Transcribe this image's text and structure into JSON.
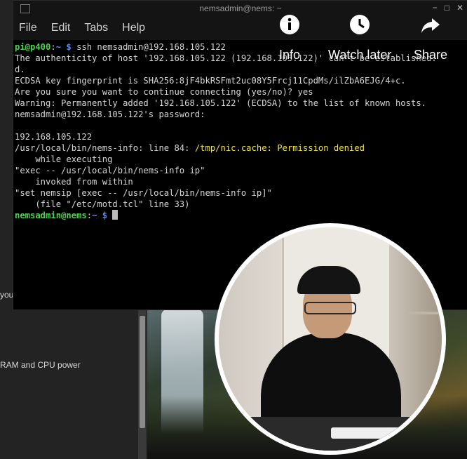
{
  "window": {
    "title": "nemsadmin@nems: ~"
  },
  "menu": [
    "File",
    "Edit",
    "Tabs",
    "Help"
  ],
  "terminal_lines": [
    [
      {
        "t": "pi@p400",
        "c": "g"
      },
      {
        "t": ":",
        "c": ""
      },
      {
        "t": "~",
        "c": "b"
      },
      {
        "t": " $ ",
        "c": "b"
      },
      {
        "t": "ssh nemsadmin@192.168.105.122",
        "c": ""
      }
    ],
    [
      {
        "t": "The authenticity of host '192.168.105.122 (192.168.105.122)' can't be established.",
        "c": ""
      }
    ],
    [
      {
        "t": "d.",
        "c": ""
      }
    ],
    [
      {
        "t": "ECDSA key fingerprint is SHA256:8jF4bkRSFmt2uc08Y5Frcj11CpdMs/ilZbA6EJG/4+c.",
        "c": ""
      }
    ],
    [
      {
        "t": "Are you sure you want to continue connecting (yes/no)? yes",
        "c": ""
      }
    ],
    [
      {
        "t": "Warning: Permanently added '192.168.105.122' (ECDSA) to the list of known hosts.",
        "c": ""
      }
    ],
    [
      {
        "t": "nemsadmin@192.168.105.122's password:",
        "c": ""
      }
    ],
    [
      {
        "t": "",
        "c": ""
      }
    ],
    [
      {
        "t": "192.168.105.122",
        "c": ""
      }
    ],
    [
      {
        "t": "/usr/local/bin/nems-info: line 84: ",
        "c": ""
      },
      {
        "t": "/tmp/nic.cache: Permission denied",
        "c": "y"
      }
    ],
    [
      {
        "t": "    while executing",
        "c": ""
      }
    ],
    [
      {
        "t": "\"exec -- /usr/local/bin/nems-info ip\"",
        "c": ""
      }
    ],
    [
      {
        "t": "    invoked from within",
        "c": ""
      }
    ],
    [
      {
        "t": "\"set nemsip [exec -- /usr/local/bin/nems-info ip]\"",
        "c": ""
      }
    ],
    [
      {
        "t": "    (file \"/etc/motd.tcl\" line 33)",
        "c": ""
      }
    ],
    [
      {
        "t": "nemsadmin@nems",
        "c": "g"
      },
      {
        "t": ":",
        "c": ""
      },
      {
        "t": "~",
        "c": "b"
      },
      {
        "t": " $ ",
        "c": "b"
      }
    ]
  ],
  "overlay": {
    "info": "Info",
    "watch_later": "Watch later",
    "share": "Share"
  },
  "background_text": {
    "line1": "you",
    "line2": "RAM and CPU power"
  }
}
